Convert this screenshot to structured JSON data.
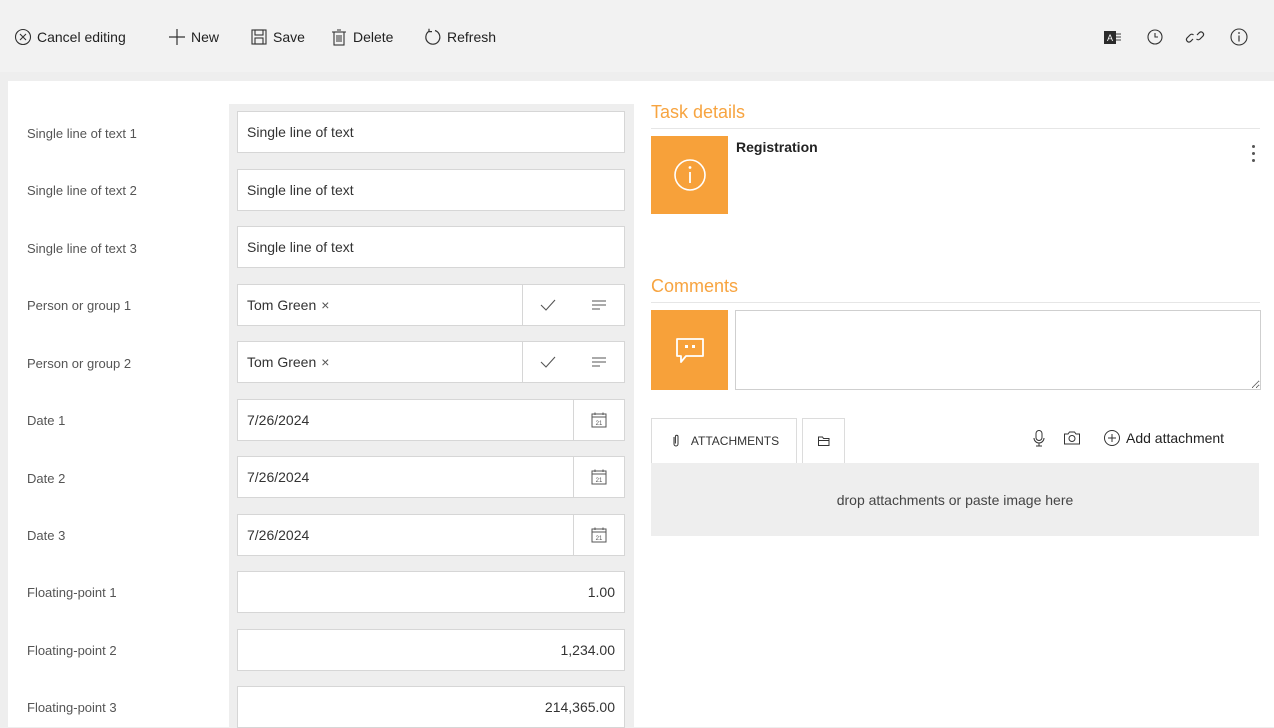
{
  "toolbar": {
    "cancel_label": "Cancel editing",
    "new_label": "New",
    "save_label": "Save",
    "delete_label": "Delete",
    "refresh_label": "Refresh",
    "right_icons": [
      "office-app-icon",
      "history-icon",
      "link-icon",
      "info-icon"
    ]
  },
  "form": {
    "fields": [
      {
        "label": "Single line of text 1",
        "value": "Single line of text"
      },
      {
        "label": "Single line of text 2",
        "value": "Single line of text"
      },
      {
        "label": "Single line of text 3",
        "value": "Single line of text"
      },
      {
        "label": "Person or group 1",
        "value": "Tom Green"
      },
      {
        "label": "Person or group 2",
        "value": "Tom Green"
      },
      {
        "label": "Date 1",
        "value": "7/26/2024"
      },
      {
        "label": "Date 2",
        "value": "7/26/2024"
      },
      {
        "label": "Date 3",
        "value": "7/26/2024"
      },
      {
        "label": "Floating-point 1",
        "value": "1.00"
      },
      {
        "label": "Floating-point 2",
        "value": "1,234.00"
      },
      {
        "label": "Floating-point 3",
        "value": "214,365.00"
      }
    ],
    "remove_mark": "×",
    "calendar_day": "21"
  },
  "task_details": {
    "title": "Task details",
    "task_name": "Registration"
  },
  "comments": {
    "title": "Comments"
  },
  "attachments": {
    "tab_label": "ATTACHMENTS",
    "add_label": "Add attachment",
    "drop_text": "drop attachments or paste image here"
  },
  "colors": {
    "accent": "#f7a13a",
    "accent_text": "#f7a440",
    "toolbar_bg": "#f2f2f2",
    "page_bg": "#eeeeee"
  }
}
